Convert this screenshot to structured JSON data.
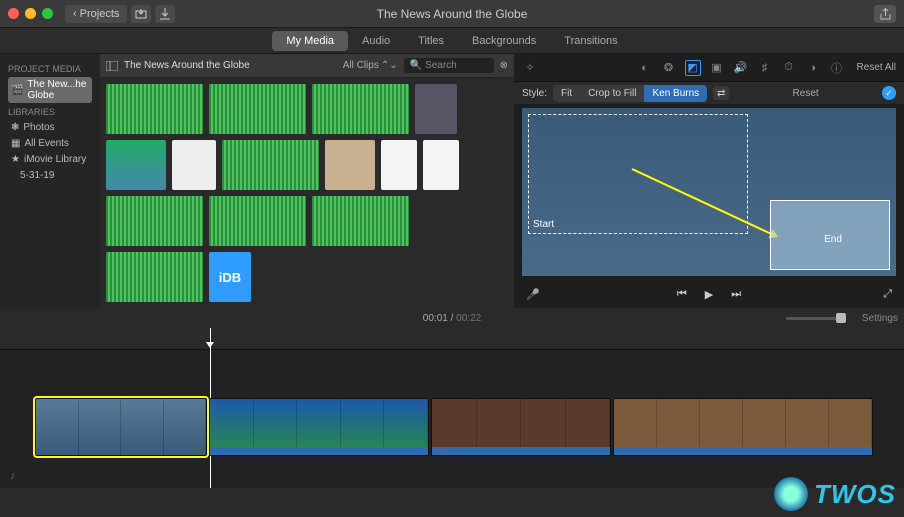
{
  "window": {
    "title": "The News Around the Globe"
  },
  "titlebar": {
    "back_label": "Projects"
  },
  "tabs": {
    "items": [
      "My Media",
      "Audio",
      "Titles",
      "Backgrounds",
      "Transitions"
    ],
    "active": 0
  },
  "sidebar": {
    "project_media_head": "PROJECT MEDIA",
    "project_item": "The New...he Globe",
    "libraries_head": "LIBRARIES",
    "photos": "Photos",
    "all_events": "All Events",
    "library": "iMovie Library",
    "event": "5-31-19"
  },
  "browser": {
    "header_name": "The News Around the Globe",
    "clips_dropdown": "All Clips",
    "search_placeholder": "Search"
  },
  "viewer": {
    "reset_all": "Reset All",
    "style_label": "Style:",
    "fit": "Fit",
    "crop_fill": "Crop to Fill",
    "ken_burns": "Ken Burns",
    "reset": "Reset",
    "kb_start_label": "Start",
    "kb_end_label": "End"
  },
  "playback": {
    "current": "00:01",
    "total": "00:22"
  },
  "timeline_header": {
    "settings": "Settings"
  },
  "watermark": {
    "text": "TWOS"
  }
}
